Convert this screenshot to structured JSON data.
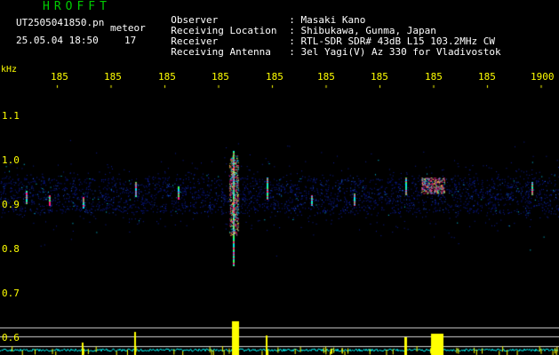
{
  "header": {
    "app_title": "HROFFT",
    "file_name": "UT2505041850.pn",
    "meteor_label": "meteor",
    "date_time": "25.05.04 18:50",
    "meteor_count": "17"
  },
  "info": [
    {
      "label": "Observer",
      "value": ": Masaki Kano"
    },
    {
      "label": "Receiving Location",
      "value": ": Shibukawa, Gunma, Japan"
    },
    {
      "label": "Receiver",
      "value": ": RTL-SDR SDR# 43dB L15 103.2MHz CW"
    },
    {
      "label": "Receiving Antenna",
      "value": ": 3el Yagi(V) Az 330 for Vladivostok"
    }
  ],
  "spectrogram": {
    "y_unit": "kHz",
    "y_ticks": [
      "1.1",
      "1.0",
      "0.9",
      "0.8",
      "0.7",
      "0.6"
    ],
    "x_ticks": [
      "185",
      "185",
      "185",
      "185",
      "185",
      "185",
      "185",
      "185",
      "185",
      "1900"
    ]
  },
  "colors": {
    "title": "#00cc00",
    "text": "#ffffff",
    "tick": "#ffff00",
    "signal_hot": "#ff2080",
    "signal_mid": "#00e0ff",
    "noise_floor": "#1020a0",
    "level_trace": "#ffff00",
    "baseline_trace": "#00ffff"
  }
}
